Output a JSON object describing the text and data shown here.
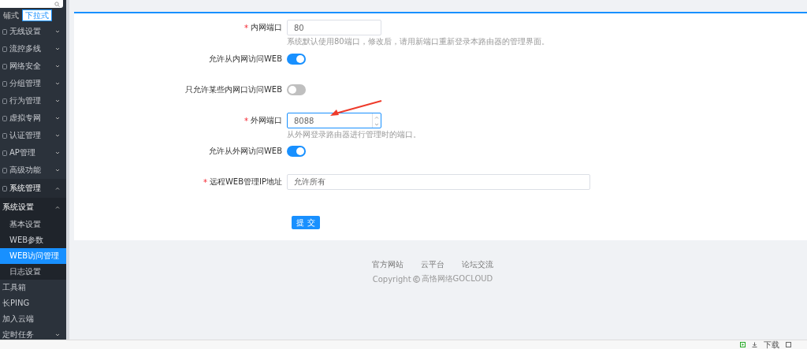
{
  "sidebar": {
    "view_tabs": [
      {
        "label": "铺式",
        "selected": false
      },
      {
        "label": "下拉式",
        "selected": true
      }
    ],
    "items": [
      {
        "label": "无线设置",
        "expanded": false
      },
      {
        "label": "流控多线",
        "expanded": false
      },
      {
        "label": "网络安全",
        "expanded": false
      },
      {
        "label": "分组管理",
        "expanded": false
      },
      {
        "label": "行为管理",
        "expanded": false
      },
      {
        "label": "虚拟专网",
        "expanded": false
      },
      {
        "label": "认证管理",
        "expanded": false
      },
      {
        "label": "AP管理",
        "expanded": false
      },
      {
        "label": "高级功能",
        "expanded": false
      },
      {
        "label": "系统管理",
        "expanded": true,
        "children": [
          {
            "label": "系统设置",
            "expanded": true,
            "children": [
              {
                "label": "基本设置",
                "selected": false
              },
              {
                "label": "WEB参数",
                "selected": false
              },
              {
                "label": "WEB访问管理",
                "selected": true
              },
              {
                "label": "日志设置",
                "selected": false
              }
            ]
          },
          {
            "label": "工具箱"
          },
          {
            "label": "长PING"
          },
          {
            "label": "加入云端"
          },
          {
            "label": "定时任务",
            "expanded": false
          }
        ]
      }
    ]
  },
  "form": {
    "fields": [
      {
        "kind": "input",
        "required_mark": "*",
        "label": "内网端口",
        "value": "80",
        "hint": "系统默认使用80端口，修改后，请用新端口重新登录本路由器的管理界面。"
      },
      {
        "kind": "switch",
        "label": "允许从内网访问WEB",
        "on": true
      },
      {
        "kind": "switch",
        "label": "只允许某些内网口访问WEB",
        "on": false
      },
      {
        "kind": "number",
        "required_mark": "*",
        "label": "外网端口",
        "value": "8088",
        "hint": "从外网登录路由器进行管理时的端口。"
      },
      {
        "kind": "switch",
        "label": "允许从外网访问WEB",
        "on": true
      },
      {
        "kind": "wide",
        "required_mark": "*",
        "label": "远程WEB管理IP地址",
        "value": "允许所有"
      }
    ],
    "submit": "提 交"
  },
  "footer": {
    "links": [
      "官方网站",
      "云平台",
      "论坛交流"
    ],
    "copyright": "Copyright",
    "company": "高恪网络GOCLOUD"
  },
  "status_bar": {
    "download": "下载"
  }
}
